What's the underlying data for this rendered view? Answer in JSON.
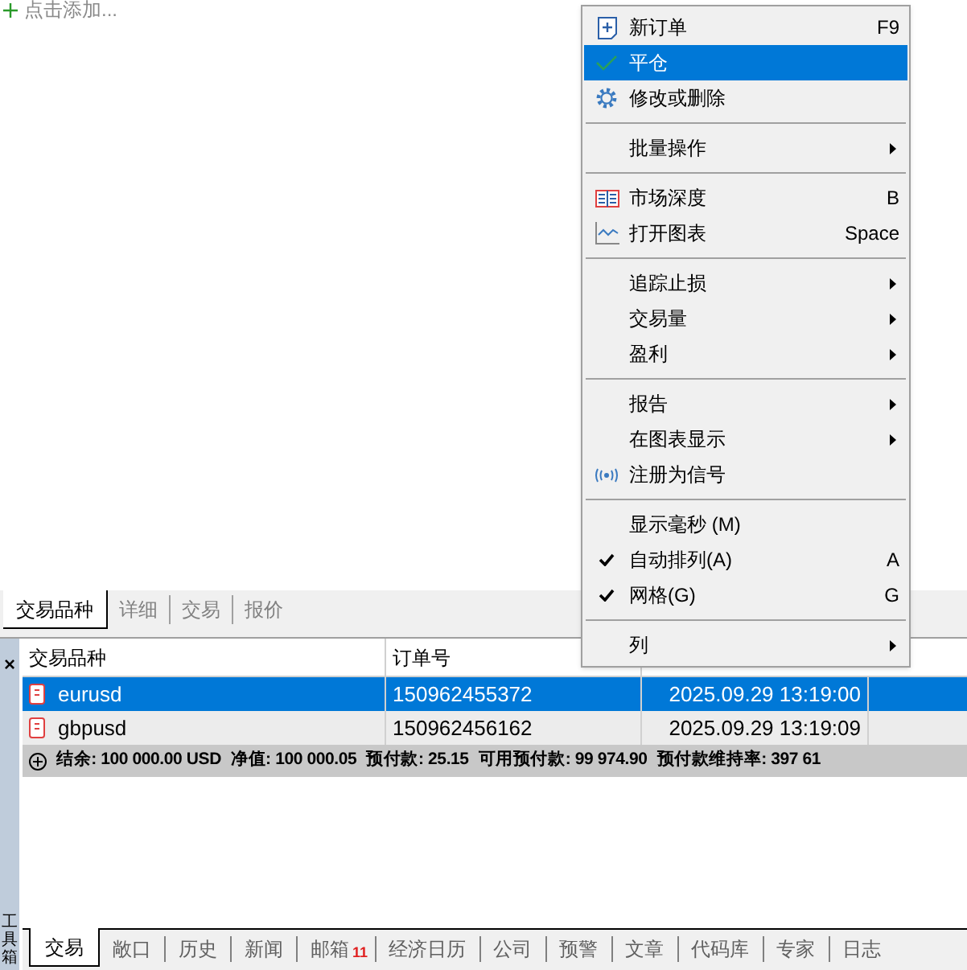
{
  "add_link": {
    "label": "点击添加..."
  },
  "panel_tabs": [
    {
      "label": "交易品种",
      "selected": true
    },
    {
      "label": "详细",
      "selected": false
    },
    {
      "label": "交易",
      "selected": false
    },
    {
      "label": "报价",
      "selected": false
    }
  ],
  "table": {
    "columns": [
      "交易品种",
      "订单号"
    ],
    "rows": [
      {
        "symbol": "eurusd",
        "order": "150962455372",
        "time": "2025.09.29 13:19:00",
        "selected": true
      },
      {
        "symbol": "gbpusd",
        "order": "150962456162",
        "time": "2025.09.29 13:19:09",
        "selected": false
      }
    ],
    "summary": [
      "结余: 100 000.00 USD",
      "净值: 100 000.05",
      "预付款: 25.15",
      "可用预付款: 99 974.90",
      "预付款维持率: 397 61"
    ]
  },
  "toolbox": {
    "close": "×",
    "title": "工具箱"
  },
  "bottom_tabs": [
    {
      "label": "交易",
      "selected": true
    },
    {
      "label": "敞口",
      "selected": false
    },
    {
      "label": "历史",
      "selected": false
    },
    {
      "label": "新闻",
      "selected": false
    },
    {
      "label": "邮箱",
      "selected": false,
      "badge": "11"
    },
    {
      "label": "经济日历",
      "selected": false
    },
    {
      "label": "公司",
      "selected": false
    },
    {
      "label": "预警",
      "selected": false
    },
    {
      "label": "文章",
      "selected": false
    },
    {
      "label": "代码库",
      "selected": false
    },
    {
      "label": "专家",
      "selected": false
    },
    {
      "label": "日志",
      "selected": false
    }
  ],
  "context_menu": [
    {
      "kind": "item",
      "label": "新订单",
      "shortcut": "F9",
      "submenu": false,
      "checked": false,
      "selected": false
    },
    {
      "kind": "item",
      "label": "平仓",
      "submenu": false,
      "checked": false,
      "selected": true
    },
    {
      "kind": "item",
      "label": "修改或删除",
      "submenu": false,
      "checked": false,
      "selected": false
    },
    {
      "kind": "separator"
    },
    {
      "kind": "item",
      "label": "批量操作",
      "submenu": true,
      "checked": false,
      "selected": false
    },
    {
      "kind": "separator"
    },
    {
      "kind": "item",
      "label": "市场深度",
      "shortcut": "B",
      "submenu": false,
      "checked": false,
      "selected": false
    },
    {
      "kind": "item",
      "label": "打开图表",
      "shortcut": "Space",
      "submenu": false,
      "checked": false,
      "selected": false
    },
    {
      "kind": "separator"
    },
    {
      "kind": "item",
      "label": "追踪止损",
      "submenu": true,
      "checked": false,
      "selected": false
    },
    {
      "kind": "item",
      "label": "交易量",
      "submenu": true,
      "checked": false,
      "selected": false
    },
    {
      "kind": "item",
      "label": "盈利",
      "submenu": true,
      "checked": false,
      "selected": false
    },
    {
      "kind": "separator"
    },
    {
      "kind": "item",
      "label": "报告",
      "submenu": true,
      "checked": false,
      "selected": false
    },
    {
      "kind": "item",
      "label": "在图表显示",
      "submenu": true,
      "checked": false,
      "selected": false
    },
    {
      "kind": "item",
      "label": "注册为信号",
      "submenu": false,
      "checked": false,
      "selected": false
    },
    {
      "kind": "separator"
    },
    {
      "kind": "item",
      "label": "显示毫秒 (M)",
      "submenu": false,
      "checked": false,
      "selected": false
    },
    {
      "kind": "item",
      "label": "自动排列(A)",
      "shortcut": "A",
      "submenu": false,
      "checked": true,
      "selected": false
    },
    {
      "kind": "item",
      "label": "网格(G)",
      "shortcut": "G",
      "submenu": false,
      "checked": true,
      "selected": false
    },
    {
      "kind": "separator"
    },
    {
      "kind": "item",
      "label": "列",
      "submenu": true,
      "checked": false,
      "selected": false
    }
  ]
}
